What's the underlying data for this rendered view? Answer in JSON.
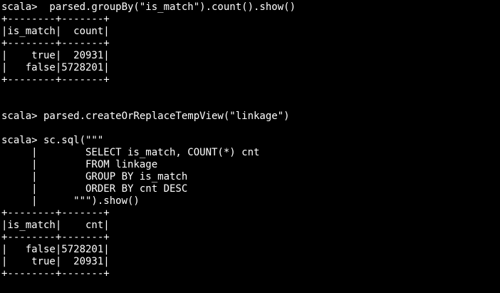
{
  "terminal": {
    "lines": [
      "scala>  parsed.groupBy(\"is_match\").count().show()",
      "+--------+-------+",
      "|is_match|  count|",
      "+--------+-------+",
      "|    true|  20931|",
      "|   false|5728201|",
      "+--------+-------+",
      "",
      "",
      "scala> parsed.createOrReplaceTempView(\"linkage\")",
      "",
      "scala> sc.sql(\"\"\"",
      "     |        SELECT is_match, COUNT(*) cnt",
      "     |        FROM linkage",
      "     |        GROUP BY is_match",
      "     |        ORDER BY cnt DESC",
      "     |      \"\"\").show()",
      "+--------+-------+",
      "|is_match|    cnt|",
      "+--------+-------+",
      "|   false|5728201|",
      "|    true|  20931|",
      "+--------+-------+"
    ]
  }
}
